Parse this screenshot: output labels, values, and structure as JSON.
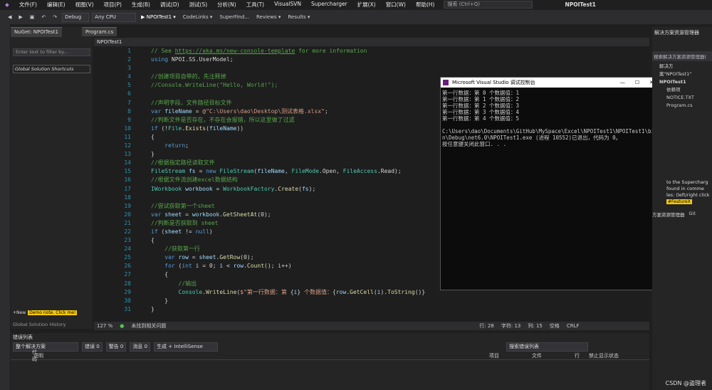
{
  "menu": {
    "items": [
      "文件(F)",
      "编辑(E)",
      "视图(V)",
      "项目(P)",
      "生成(B)",
      "调试(D)",
      "测试(S)",
      "分析(N)",
      "工具(T)",
      "VisualSVN",
      "Supercharger",
      "扩展(X)",
      "窗口(W)",
      "帮助(H)"
    ],
    "search_placeholder": "搜索 (Ctrl+Q)",
    "window_title": "NPOITest1"
  },
  "toolbar": {
    "config": "Debug",
    "platform": "Any CPU",
    "run_label": "▶ NPOITest1 ▾",
    "codelinks": "CodeLinks ▾",
    "superfind": "SuperFind...",
    "reviews": "Reviews ▾",
    "results": "Results ▾"
  },
  "left_panel": {
    "tab": "NuGet: NPOITest1",
    "filter_placeholder": "Enter text to filter by...",
    "item": "Global Solution Shortcuts",
    "new_btn": "+New",
    "demo": "Demo note. Click me!",
    "history": "Global Solution History"
  },
  "editor": {
    "tab": "Program.cs",
    "nav": "NPOITest1",
    "lines": [
      [
        [
          "c-cm",
          "// See "
        ],
        [
          "c-ln",
          "https://aka.ms/new-console-template"
        ],
        [
          "c-cm",
          " for more information"
        ]
      ],
      [
        [
          "c-kw",
          "using"
        ],
        [
          "c-tx",
          " NPOI.SS.UserModel;"
        ]
      ],
      [],
      [
        [
          "c-cm",
          "//创建项目自带的，先注释掉"
        ]
      ],
      [
        [
          "c-cm",
          "//Console.WriteLine(\"Hello, World!\");"
        ]
      ],
      [],
      [
        [
          "c-cm",
          "//声明字段，文件路径目标文件"
        ]
      ],
      [
        [
          "c-kw",
          "var"
        ],
        [
          "c-id",
          " fileName"
        ],
        [
          "c-tx",
          " = "
        ],
        [
          "c-st",
          "@\"C:\\Users\\dao\\Desktop\\测试表格.xlsx\""
        ],
        [
          "c-tx",
          ";"
        ]
      ],
      [
        [
          "c-cm",
          "//判断文件是否存在，不存在会报错，所以这里做了过滤"
        ]
      ],
      [
        [
          "c-kw",
          "if"
        ],
        [
          "c-tx",
          " (!"
        ],
        [
          "c-ty",
          "File"
        ],
        [
          "c-tx",
          "."
        ],
        [
          "c-fn",
          "Exists"
        ],
        [
          "c-tx",
          "("
        ],
        [
          "c-id",
          "fileName"
        ],
        [
          "c-tx",
          "))"
        ]
      ],
      [
        [
          "c-tx",
          "{"
        ]
      ],
      [
        [
          "c-kw",
          "    return"
        ],
        [
          "c-tx",
          ";"
        ]
      ],
      [
        [
          "c-tx",
          "}"
        ]
      ],
      [
        [
          "c-cm",
          "//根据指定路径读取文件"
        ]
      ],
      [
        [
          "c-ty",
          "FileStream"
        ],
        [
          "c-id",
          " fs"
        ],
        [
          "c-tx",
          " = "
        ],
        [
          "c-kw",
          "new"
        ],
        [
          "c-ty",
          " FileStream"
        ],
        [
          "c-tx",
          "("
        ],
        [
          "c-id",
          "fileName"
        ],
        [
          "c-tx",
          ", "
        ],
        [
          "c-ty",
          "FileMode"
        ],
        [
          "c-tx",
          ".Open, "
        ],
        [
          "c-ty",
          "FileAccess"
        ],
        [
          "c-tx",
          ".Read);"
        ]
      ],
      [
        [
          "c-cm",
          "//根据文件流创建excel数据结构"
        ]
      ],
      [
        [
          "c-ty",
          "IWorkbook"
        ],
        [
          "c-id",
          " workbook"
        ],
        [
          "c-tx",
          " = "
        ],
        [
          "c-ty",
          "WorkbookFactory"
        ],
        [
          "c-tx",
          "."
        ],
        [
          "c-fn",
          "Create"
        ],
        [
          "c-tx",
          "("
        ],
        [
          "c-id",
          "fs"
        ],
        [
          "c-tx",
          ");"
        ]
      ],
      [],
      [
        [
          "c-cm",
          "//尝试获取第一个sheet"
        ]
      ],
      [
        [
          "c-kw",
          "var"
        ],
        [
          "c-id",
          " sheet"
        ],
        [
          "c-tx",
          " = "
        ],
        [
          "c-id",
          "workbook"
        ],
        [
          "c-tx",
          "."
        ],
        [
          "c-fn",
          "GetSheetAt"
        ],
        [
          "c-tx",
          "(0);"
        ]
      ],
      [
        [
          "c-cm",
          "//判断是否获取到 sheet"
        ]
      ],
      [
        [
          "c-kw",
          "if"
        ],
        [
          "c-tx",
          " ("
        ],
        [
          "c-id",
          "sheet"
        ],
        [
          "c-tx",
          " != "
        ],
        [
          "c-kw",
          "null"
        ],
        [
          "c-tx",
          ")"
        ]
      ],
      [
        [
          "c-tx",
          "{"
        ]
      ],
      [
        [
          "c-cm",
          "    //获取第一行"
        ]
      ],
      [
        [
          "c-kw",
          "    var"
        ],
        [
          "c-id",
          " row"
        ],
        [
          "c-tx",
          " = "
        ],
        [
          "c-id",
          "sheet"
        ],
        [
          "c-tx",
          "."
        ],
        [
          "c-fn",
          "GetRow"
        ],
        [
          "c-tx",
          "(0);"
        ]
      ],
      [
        [
          "c-kw",
          "    for"
        ],
        [
          "c-tx",
          " ("
        ],
        [
          "c-kw",
          "int"
        ],
        [
          "c-id",
          " i"
        ],
        [
          "c-tx",
          " = 0; "
        ],
        [
          "c-id",
          "i"
        ],
        [
          "c-tx",
          " < "
        ],
        [
          "c-id",
          "row"
        ],
        [
          "c-tx",
          "."
        ],
        [
          "c-fn",
          "Count"
        ],
        [
          "c-tx",
          "(); "
        ],
        [
          "c-id",
          "i"
        ],
        [
          "c-tx",
          "++)"
        ]
      ],
      [
        [
          "c-tx",
          "    {"
        ]
      ],
      [
        [
          "c-cm",
          "        //输出"
        ]
      ],
      [
        [
          "c-ty",
          "        Console"
        ],
        [
          "c-tx",
          "."
        ],
        [
          "c-fn",
          "WriteLine"
        ],
        [
          "c-tx",
          "("
        ],
        [
          "c-st",
          "$\"第一行数据：第 "
        ],
        [
          "c-tx",
          "{"
        ],
        [
          "c-id",
          "i"
        ],
        [
          "c-tx",
          "}"
        ],
        [
          "c-st",
          " 个数据值："
        ],
        [
          "c-tx",
          "{"
        ],
        [
          "c-id",
          "row"
        ],
        [
          "c-tx",
          "."
        ],
        [
          "c-fn",
          "GetCell"
        ],
        [
          "c-tx",
          "("
        ],
        [
          "c-id",
          "i"
        ],
        [
          "c-tx",
          ")."
        ],
        [
          "c-fn",
          "ToString"
        ],
        [
          "c-tx",
          "()}"
        ]
      ],
      [
        [
          "c-tx",
          "    }"
        ]
      ],
      [
        [
          "c-tx",
          "}"
        ]
      ]
    ]
  },
  "console": {
    "title": "Microsoft Visual Studio 调试控制台",
    "output": "第一行数据：第 0 个数据值：1\n第一行数据：第 1 个数据值：2\n第一行数据：第 2 个数据值：3\n第一行数据：第 3 个数据值：4\n第一行数据：第 4 个数据值：5\n\nC:\\Users\\dao\\Documents\\GitHub\\MySpace\\Excel\\NPOITest1\\NPOITest1\\bi\nn\\Debug\\net6.0\\NPOITest1.exe (进程 10552)已退出，代码为 0。\n按任意键关闭此窗口. . ."
  },
  "right_panel": {
    "title": "解决方案资源管理器",
    "search": "搜索解决方案资源管理器(",
    "solution": "解决方案\"NPOITest1\"",
    "project": "NPOITest1",
    "deps": "依赖项",
    "notice": "NOTICE.TXT",
    "program": "Program.cs",
    "tip1": "to the Supercharg",
    "tip2": "found in comme",
    "tip3": "les: (left/right click",
    "tag1": "#FeatureX",
    "tab_sol": "方案资源管理器",
    "tab_git": "Git"
  },
  "status": {
    "zoom": "127 %",
    "issues": "未找到相关问题",
    "row": "行: 28",
    "char": "字符: 13",
    "col": "列: 15",
    "tab": "空格",
    "eol": "CRLF"
  },
  "errors": {
    "title": "错误列表",
    "scope": "整个解决方案",
    "err": "错误 0",
    "warn": "警告 0",
    "msg": "消息 0",
    "build": "生成 + IntelliSense",
    "search": "搜索错误列表",
    "cols": [
      "代码",
      "说明",
      "项目",
      "文件",
      "行",
      "禁止显示状态"
    ]
  },
  "watermark": "CSDN @盗理者"
}
